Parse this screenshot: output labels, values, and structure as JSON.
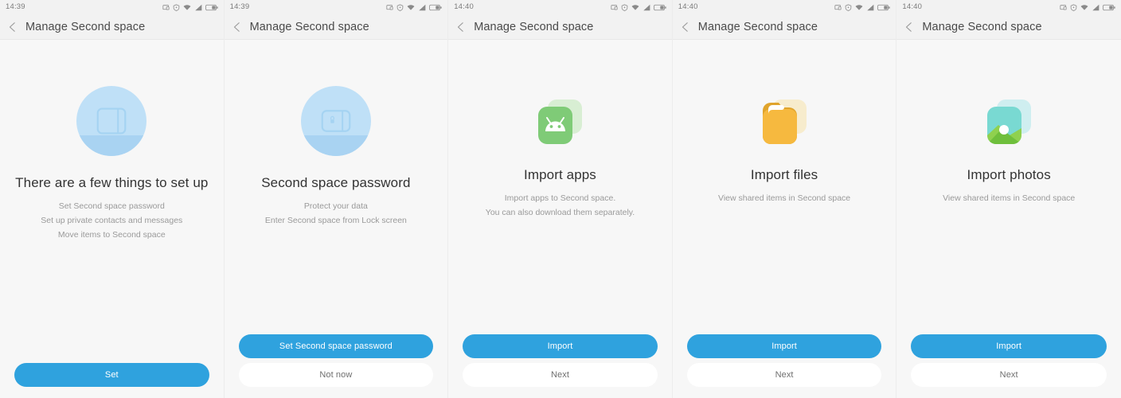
{
  "screens": [
    {
      "statusbar": {
        "time": "14:39",
        "icons": [
          "screen-cast-icon",
          "shield-icon",
          "wifi-icon",
          "signal-icon",
          "battery-icon"
        ]
      },
      "titlebar": {
        "back_icon": "chevron-left-icon",
        "title": "Manage Second space"
      },
      "hero": {
        "art": "second-space-circle-icon",
        "headline": "There are a few things to set up",
        "sublines": [
          "Set Second space password",
          "Set up private contacts and messages",
          "Move items to Second space"
        ]
      },
      "buttons": [
        {
          "label": "Set",
          "style": "primary",
          "name": "set-button"
        }
      ]
    },
    {
      "statusbar": {
        "time": "14:39",
        "icons": [
          "screen-cast-icon",
          "shield-icon",
          "wifi-icon",
          "signal-icon",
          "battery-icon"
        ]
      },
      "titlebar": {
        "back_icon": "chevron-left-icon",
        "title": "Manage Second space"
      },
      "hero": {
        "art": "second-space-lock-circle-icon",
        "headline": "Second space password",
        "sublines": [
          "Protect your data",
          "Enter Second space from Lock screen"
        ]
      },
      "buttons": [
        {
          "label": "Set Second space password",
          "style": "primary",
          "name": "set-second-space-password-button"
        },
        {
          "label": "Not now",
          "style": "secondary",
          "name": "not-now-button"
        }
      ]
    },
    {
      "statusbar": {
        "time": "14:40",
        "icons": [
          "screen-cast-icon",
          "shield-icon",
          "wifi-icon",
          "signal-icon",
          "battery-icon"
        ]
      },
      "titlebar": {
        "back_icon": "chevron-left-icon",
        "title": "Manage Second space"
      },
      "hero": {
        "art": "android-apps-icon",
        "headline": "Import apps",
        "sublines": [
          "Import apps to Second space.",
          "You can also download them separately."
        ]
      },
      "buttons": [
        {
          "label": "Import",
          "style": "primary",
          "name": "import-button"
        },
        {
          "label": "Next",
          "style": "secondary",
          "name": "next-button"
        }
      ]
    },
    {
      "statusbar": {
        "time": "14:40",
        "icons": [
          "screen-cast-icon",
          "shield-icon",
          "wifi-icon",
          "signal-icon",
          "battery-icon"
        ]
      },
      "titlebar": {
        "back_icon": "chevron-left-icon",
        "title": "Manage Second space"
      },
      "hero": {
        "art": "folder-files-icon",
        "headline": "Import files",
        "sublines": [
          "View shared items in Second space"
        ]
      },
      "buttons": [
        {
          "label": "Import",
          "style": "primary",
          "name": "import-button"
        },
        {
          "label": "Next",
          "style": "secondary",
          "name": "next-button"
        }
      ]
    },
    {
      "statusbar": {
        "time": "14:40",
        "icons": [
          "screen-cast-icon",
          "shield-icon",
          "wifi-icon",
          "signal-icon",
          "battery-icon"
        ]
      },
      "titlebar": {
        "back_icon": "chevron-left-icon",
        "title": "Manage Second space"
      },
      "hero": {
        "art": "photos-gallery-icon",
        "headline": "Import photos",
        "sublines": [
          "View shared items in Second space"
        ]
      },
      "buttons": [
        {
          "label": "Import",
          "style": "primary",
          "name": "import-button"
        },
        {
          "label": "Next",
          "style": "secondary",
          "name": "next-button"
        }
      ]
    }
  ],
  "colors": {
    "accent": "#2fa2de",
    "circle_art": "#bfe0f7",
    "android_green": "#7fcb77",
    "folder_orange": "#f6b93f",
    "photo_sky": "#79d9d2",
    "photo_hill": "#7cc84f",
    "statusbar_bg": "#f2f2f2",
    "page_bg": "#f7f7f7"
  }
}
